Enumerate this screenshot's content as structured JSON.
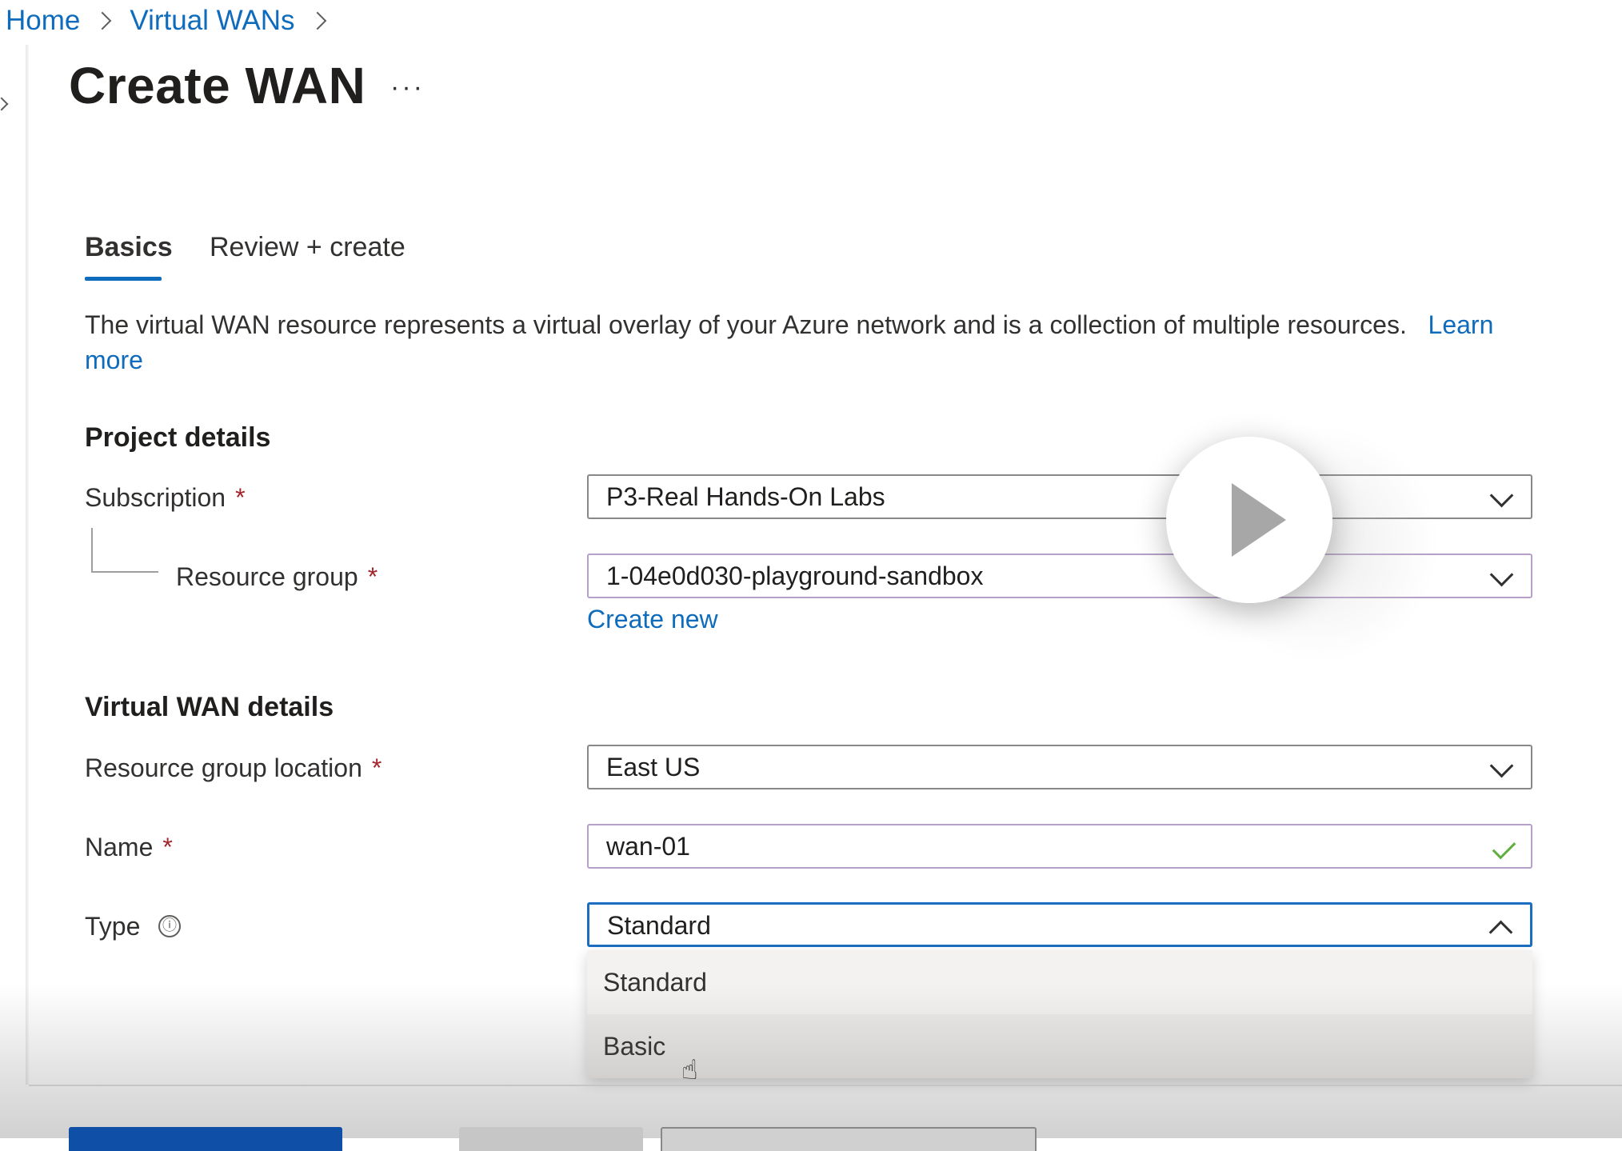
{
  "breadcrumb": {
    "home": "Home",
    "parent": "Virtual WANs"
  },
  "page": {
    "title": "Create WAN",
    "more": "···"
  },
  "tabs": [
    {
      "label": "Basics",
      "active": true
    },
    {
      "label": "Review + create",
      "active": false
    }
  ],
  "description": {
    "text": "The virtual WAN resource represents a virtual overlay of your Azure network and is a collection of multiple resources.",
    "learn_more": "Learn more"
  },
  "project_details": {
    "heading": "Project details",
    "subscription": {
      "label": "Subscription",
      "required": "*",
      "value": "P3-Real Hands-On Labs"
    },
    "resource_group": {
      "label": "Resource group",
      "required": "*",
      "value": "1-04e0d030-playground-sandbox",
      "create_new": "Create new"
    }
  },
  "wan_details": {
    "heading": "Virtual WAN details",
    "location": {
      "label": "Resource group location",
      "required": "*",
      "value": "East US"
    },
    "name": {
      "label": "Name",
      "required": "*",
      "value": "wan-01",
      "valid": true
    },
    "type": {
      "label": "Type",
      "info_icon": "ⓘ",
      "value": "Standard",
      "expanded": true,
      "options": [
        "Standard",
        "Basic"
      ],
      "hovered_option": "Basic"
    }
  },
  "overlay": {
    "play_icon": "play-icon"
  },
  "colors": {
    "accent": "#0f6cbd",
    "required": "#a4262c",
    "valid": "#5fae3e"
  }
}
